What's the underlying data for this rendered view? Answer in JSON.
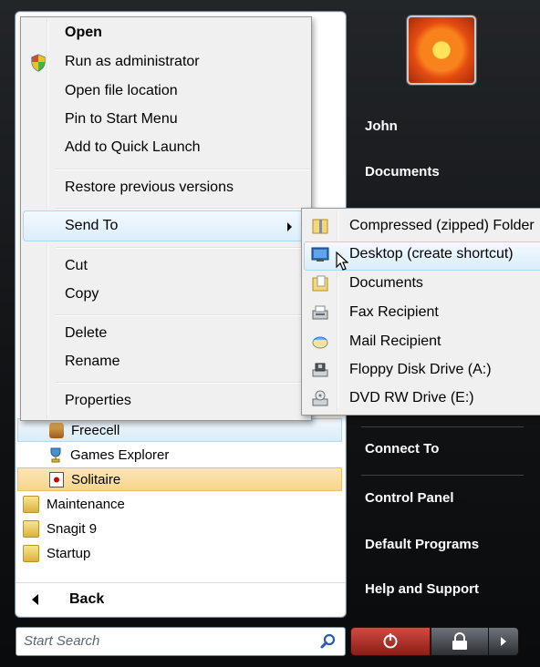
{
  "left_pane": {
    "programs": [
      {
        "label": "Freecell",
        "icon": "freecell-icon"
      },
      {
        "label": "Games Explorer",
        "icon": "trophy-icon"
      },
      {
        "label": "Solitaire",
        "icon": "solitaire-icon"
      },
      {
        "label": "Maintenance",
        "icon": "folder-icon"
      },
      {
        "label": "Snagit 9",
        "icon": "folder-icon"
      },
      {
        "label": "Startup",
        "icon": "folder-icon"
      }
    ],
    "back_label": "Back"
  },
  "search": {
    "placeholder": "Start Search"
  },
  "right_pane": {
    "items": [
      "John",
      "Documents",
      "Connect To",
      "Control Panel",
      "Default Programs",
      "Help and Support"
    ]
  },
  "context_menu": {
    "items": [
      "Open",
      "Run as administrator",
      "Open file location",
      "Pin to Start Menu",
      "Add to Quick Launch",
      "Restore previous versions",
      "Send To",
      "Cut",
      "Copy",
      "Delete",
      "Rename",
      "Properties"
    ]
  },
  "send_to_menu": {
    "items": [
      "Compressed (zipped) Folder",
      "Desktop (create shortcut)",
      "Documents",
      "Fax Recipient",
      "Mail Recipient",
      "Floppy Disk Drive (A:)",
      "DVD RW Drive (E:)"
    ]
  },
  "colors": {
    "highlight_blue": "#dbeefb",
    "highlight_orange": "#f7d58c",
    "right_pane_bg": "#141618"
  }
}
